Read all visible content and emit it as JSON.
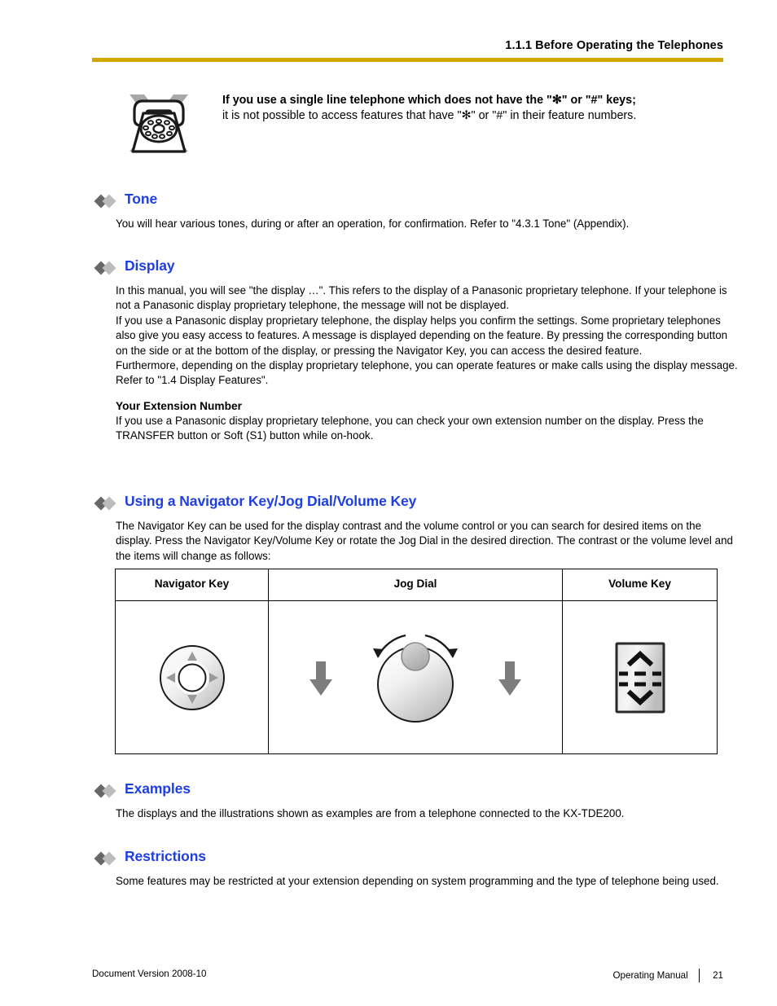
{
  "header": {
    "title": "1.1.1 Before Operating the Telephones",
    "rule_color": "#d3a600"
  },
  "notice": {
    "icon": "rotary-telephone-crossed-out-icon",
    "bold_line": "If you use a single line telephone which does not have the \"✻\" or \"#\" keys;",
    "normal_line": "it is not possible to access features that have \"✻\" or \"#\" in their feature numbers."
  },
  "accent_color": "#1f3fe0",
  "sections": [
    {
      "title": "Tone",
      "paragraphs": [
        "You will hear various tones, during or after an operation, for confirmation. Refer to \"4.3.1  Tone\" (Appendix)."
      ]
    },
    {
      "title": "Display",
      "paragraphs": [
        "In this manual, you will see \"the display …\". This refers to the display of a Panasonic proprietary telephone. If your telephone is not a Panasonic display proprietary telephone, the message will not be displayed.",
        "If you use a Panasonic display proprietary telephone, the display helps you confirm the settings. Some proprietary telephones also give you easy access to features. A message is displayed depending on the feature. By pressing the corresponding button on the side or at the bottom of the display, or pressing the Navigator Key, you can access the desired feature.",
        "Furthermore, depending on the display proprietary telephone, you can operate features or make calls using the display message. Refer to \"1.4  Display Features\"."
      ],
      "subsection": {
        "heading": "Your Extension Number",
        "paragraphs": [
          "If you use a Panasonic display proprietary telephone, you can check your own extension number on the display. Press the TRANSFER button or Soft (S1) button while on-hook."
        ]
      }
    },
    {
      "title": "Using a Navigator Key/Jog Dial/Volume Key",
      "paragraphs": [
        "The Navigator Key can be used for the display contrast and the volume control or you can search for desired items on the display. Press the Navigator Key/Volume Key or rotate the Jog Dial in the desired direction. The contrast or the volume level and the items will change as follows:"
      ]
    },
    {
      "title": "Examples",
      "paragraphs": [
        "The displays and the illustrations shown as examples are from a telephone connected to the KX-TDE200."
      ]
    },
    {
      "title": "Restrictions",
      "paragraphs": [
        "Some features may be restricted at your extension depending on system programming and the type of telephone being used."
      ]
    }
  ],
  "key_table": {
    "columns": [
      "Navigator Key",
      "Jog Dial",
      "Volume Key"
    ],
    "illustrations": [
      "navigator-key-icon",
      "jog-dial-icon",
      "volume-key-icon"
    ]
  },
  "footer": {
    "document_version": "Document Version  2008-10",
    "manual_name": "Operating Manual",
    "page_number": "21"
  }
}
